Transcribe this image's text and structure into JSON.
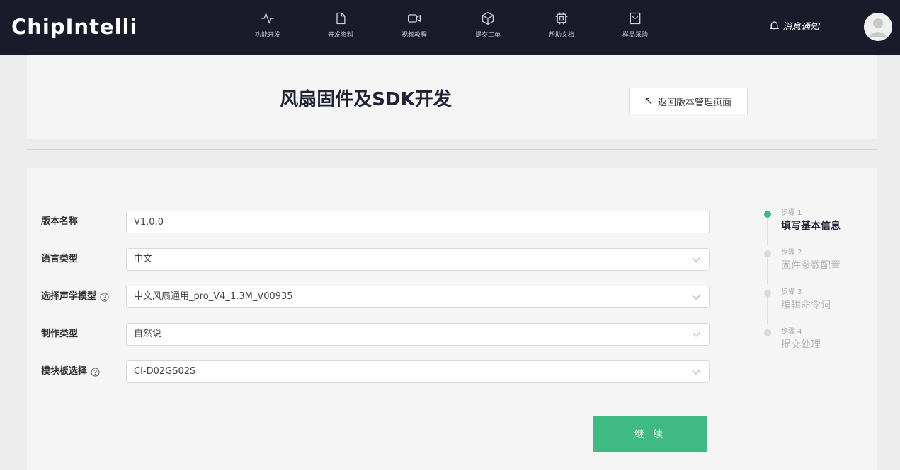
{
  "topbar": {
    "logo": "ChipIntelli",
    "nav": [
      {
        "label": "功能开发",
        "icon": "activity-icon"
      },
      {
        "label": "开发资料",
        "icon": "document-icon"
      },
      {
        "label": "视频教程",
        "icon": "video-icon"
      },
      {
        "label": "提交工单",
        "icon": "box-icon"
      },
      {
        "label": "帮助文档",
        "icon": "chip-icon"
      },
      {
        "label": "样品采购",
        "icon": "shopping-bag-icon"
      }
    ],
    "notification_label": "消息通知",
    "notification_icon": "bell-icon",
    "avatar_icon": "user-avatar-icon"
  },
  "header": {
    "title": "风扇固件及SDK开发",
    "back_button_label": "返回版本管理页面",
    "back_icon": "arrow-up-left-icon"
  },
  "form": {
    "fields": [
      {
        "label": "版本名称",
        "value": "V1.0.0",
        "type": "input",
        "help": false
      },
      {
        "label": "语言类型",
        "value": "中文",
        "type": "select",
        "help": false
      },
      {
        "label": "选择声学模型",
        "value": "中文风扇通用_pro_V4_1.3M_V00935",
        "type": "select",
        "help": true
      },
      {
        "label": "制作类型",
        "value": "自然说",
        "type": "select",
        "help": false
      },
      {
        "label": "模块板选择",
        "value": "CI-D02GS02S",
        "type": "select",
        "help": true
      }
    ],
    "continue_label": "继 续"
  },
  "steps": [
    {
      "num": "步骤 1",
      "name": "填写基本信息",
      "active": true
    },
    {
      "num": "步骤 2",
      "name": "固件参数配置",
      "active": false
    },
    {
      "num": "步骤 3",
      "name": "编辑命令词",
      "active": false
    },
    {
      "num": "步骤 4",
      "name": "提交处理",
      "active": false
    }
  ],
  "colors": {
    "topbar_bg": "#1a1b2a",
    "accent_green": "#3fba84",
    "page_bg": "#ececec",
    "panel_bg": "#f5f5f5"
  }
}
